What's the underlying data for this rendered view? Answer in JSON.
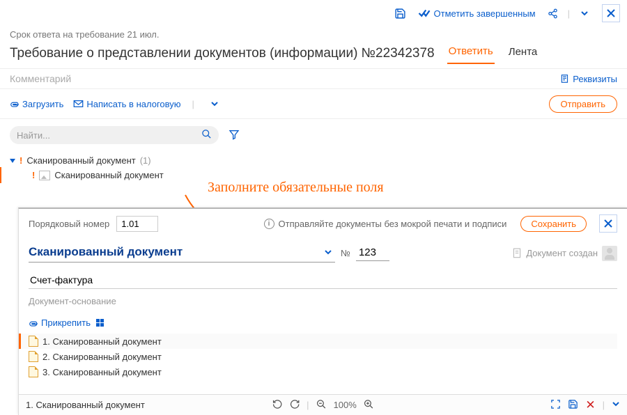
{
  "topbar": {
    "mark_complete": "Отметить завершенным"
  },
  "subheader": "Срок ответа на требование 21 июл.",
  "title": "Требование о представлении документов (информации) №22342378",
  "tabs": {
    "reply": "Ответить",
    "feed": "Лента"
  },
  "comment_placeholder": "Комментарий",
  "requisites": "Реквизиты",
  "actions": {
    "upload": "Загрузить",
    "write_tax": "Написать в налоговую",
    "send": "Отправить"
  },
  "search_placeholder": "Найти...",
  "tree": {
    "parent": "Сканированный документ",
    "count": "(1)",
    "child": "Сканированный документ"
  },
  "annotation": "Заполните обязательные поля",
  "panel": {
    "ord_label": "Порядковый номер",
    "ord_value": "1.01",
    "hint": "Отправляйте документы без мокрой печати и подписи",
    "save": "Сохранить",
    "doc_type": "Сканированный документ",
    "num_label": "№",
    "num_value": "123",
    "doc_created": "Документ создан",
    "sf_value": "Счет-фактура",
    "doc_basis": "Документ-основание",
    "attach": "Прикрепить",
    "attachments": [
      "1. Сканированный документ",
      "2. Сканированный документ",
      "3. Сканированный документ"
    ],
    "footer_current": "1. Сканированный документ",
    "zoom": "100%"
  }
}
